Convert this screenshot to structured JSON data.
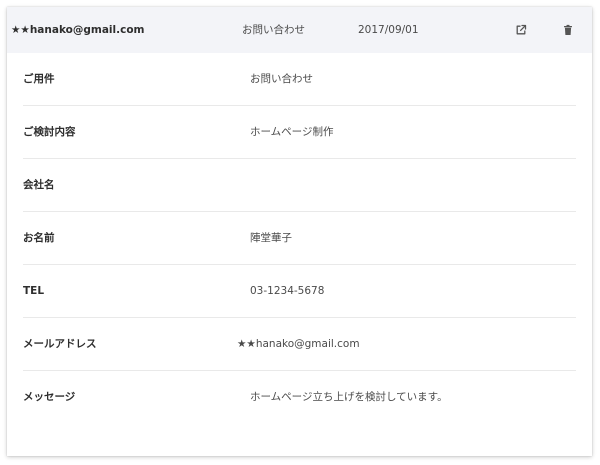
{
  "header": {
    "email": "★★hanako@gmail.com",
    "subject": "お問い合わせ",
    "date": "2017/09/01",
    "open_icon": "external-link-icon",
    "delete_icon": "trash-icon"
  },
  "fields": [
    {
      "label": "ご用件",
      "value": "お問い合わせ"
    },
    {
      "label": "ご検討内容",
      "value": "ホームページ制作"
    },
    {
      "label": "会社名",
      "value": ""
    },
    {
      "label": "お名前",
      "value": "陣堂華子"
    },
    {
      "label": "TEL",
      "value": "03-1234-5678"
    },
    {
      "label": "メールアドレス",
      "value": "★★hanako@gmail.com"
    },
    {
      "label": "メッセージ",
      "value": "ホームページ立ち上げを検討しています。"
    }
  ],
  "colors": {
    "header_bg": "#f3f4f8",
    "label_text": "#2e2e2e",
    "value_text": "#4a4a4a",
    "divider": "#e9e9e9"
  }
}
